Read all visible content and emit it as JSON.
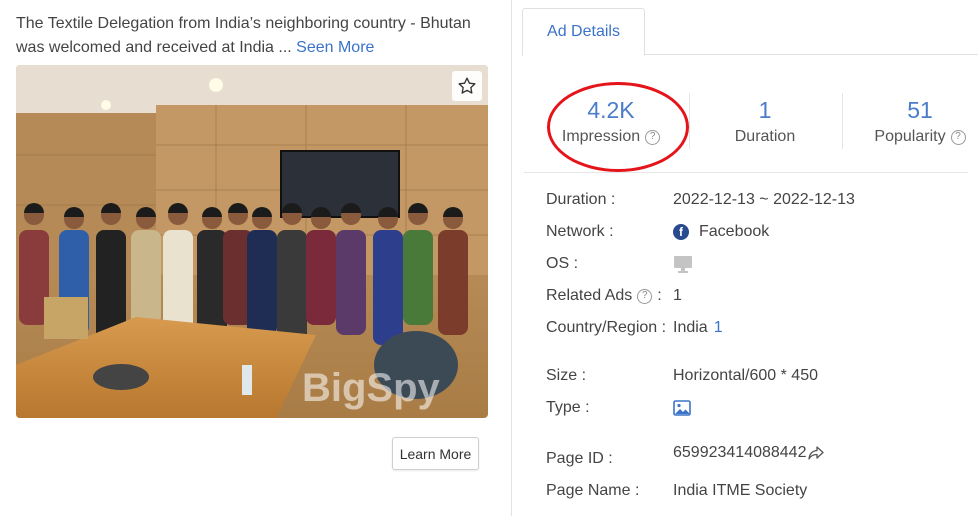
{
  "ad": {
    "description": "The Textile Delegation from India’s neighboring country - Bhutan was welcomed and received at India ...",
    "see_more": "Seen More",
    "watermark": "BigSpy",
    "learn_more": "Learn More"
  },
  "tabs": {
    "ad_details": "Ad Details"
  },
  "stats": [
    {
      "value": "4.2K",
      "label": "Impression"
    },
    {
      "value": "1",
      "label": "Duration"
    },
    {
      "value": "51",
      "label": "Popularity"
    }
  ],
  "details": {
    "duration_label": "Duration :",
    "duration_value": "2022-12-13 ~ 2022-12-13",
    "network_label": "Network :",
    "network_value": "Facebook",
    "os_label": "OS :",
    "related_label": "Related Ads",
    "related_colon": ":",
    "related_value": "1",
    "country_label": "Country/Region :",
    "country_value": "India",
    "country_count": "1",
    "size_label": "Size :",
    "size_value": "Horizontal/600 * 450",
    "type_label": "Type :",
    "page_id_label": "Page ID :",
    "page_id_value": "659923414088442",
    "page_name_label": "Page Name :",
    "page_name_value": "India ITME Society"
  },
  "colors": {
    "accent": "#3b73c7",
    "highlight_ring": "#e5141b",
    "facebook": "#2a4a8f"
  },
  "icons": [
    "star-icon",
    "help-icon",
    "facebook-icon",
    "monitor-icon",
    "image-icon",
    "share-arrow-icon"
  ]
}
